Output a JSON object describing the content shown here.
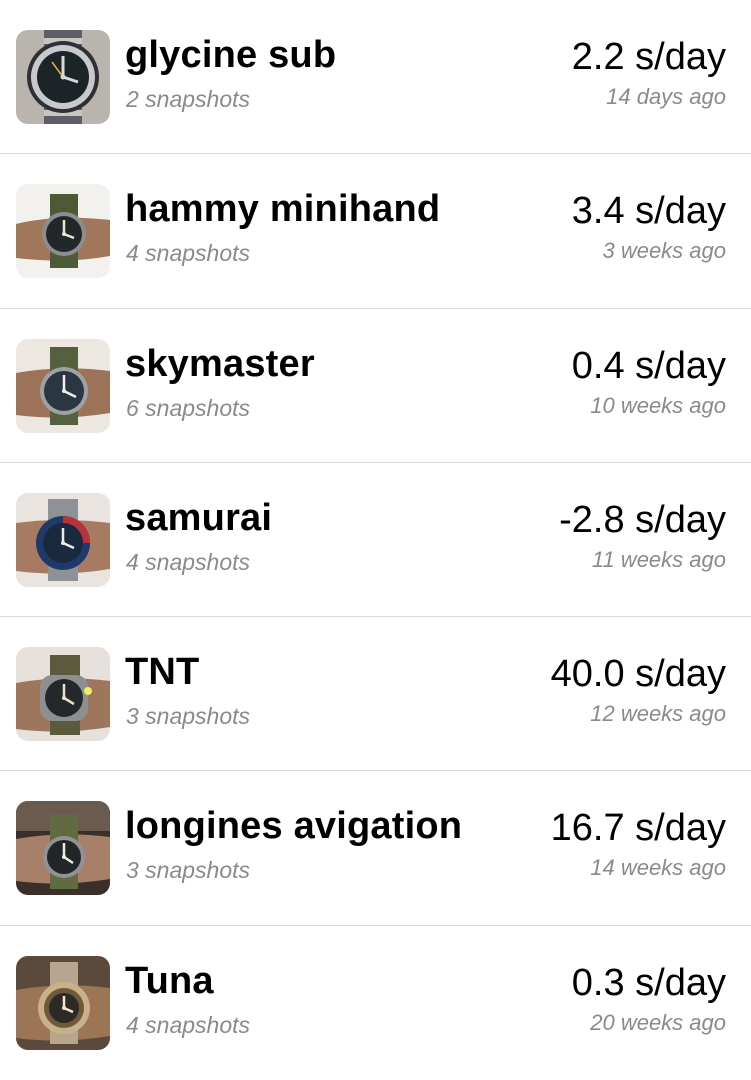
{
  "watches": [
    {
      "name": "glycine sub",
      "snapshots": "2 snapshots",
      "rate": "2.2 s/day",
      "ago": "14 days ago",
      "thumb_icon": "watch-photo-glycine-sub-icon"
    },
    {
      "name": "hammy minihand",
      "snapshots": "4 snapshots",
      "rate": "3.4 s/day",
      "ago": "3 weeks ago",
      "thumb_icon": "watch-photo-hammy-minihand-icon"
    },
    {
      "name": "skymaster",
      "snapshots": "6 snapshots",
      "rate": "0.4 s/day",
      "ago": "10 weeks ago",
      "thumb_icon": "watch-photo-skymaster-icon"
    },
    {
      "name": "samurai",
      "snapshots": "4 snapshots",
      "rate": "-2.8 s/day",
      "ago": "11 weeks ago",
      "thumb_icon": "watch-photo-samurai-icon"
    },
    {
      "name": "TNT",
      "snapshots": "3 snapshots",
      "rate": "40.0 s/day",
      "ago": "12 weeks ago",
      "thumb_icon": "watch-photo-tnt-icon"
    },
    {
      "name": "longines avigation",
      "snapshots": "3 snapshots",
      "rate": "16.7 s/day",
      "ago": "14 weeks ago",
      "thumb_icon": "watch-photo-longines-avigation-icon"
    },
    {
      "name": "Tuna",
      "snapshots": "4 snapshots",
      "rate": "0.3 s/day",
      "ago": "20 weeks ago",
      "thumb_icon": "watch-photo-tuna-icon"
    }
  ],
  "colors": {
    "title": "#000000",
    "secondary_text": "#8a8a8a",
    "separator": "#d8d8d8",
    "background": "#ffffff"
  }
}
